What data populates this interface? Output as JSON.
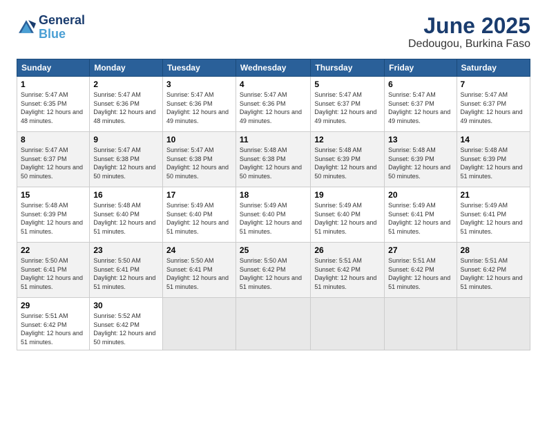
{
  "logo": {
    "line1": "General",
    "line2": "Blue"
  },
  "title": "June 2025",
  "subtitle": "Dedougou, Burkina Faso",
  "headers": [
    "Sunday",
    "Monday",
    "Tuesday",
    "Wednesday",
    "Thursday",
    "Friday",
    "Saturday"
  ],
  "weeks": [
    [
      {
        "day": "1",
        "sunrise": "5:47 AM",
        "sunset": "6:35 PM",
        "daylight": "12 hours and 48 minutes."
      },
      {
        "day": "2",
        "sunrise": "5:47 AM",
        "sunset": "6:36 PM",
        "daylight": "12 hours and 48 minutes."
      },
      {
        "day": "3",
        "sunrise": "5:47 AM",
        "sunset": "6:36 PM",
        "daylight": "12 hours and 49 minutes."
      },
      {
        "day": "4",
        "sunrise": "5:47 AM",
        "sunset": "6:36 PM",
        "daylight": "12 hours and 49 minutes."
      },
      {
        "day": "5",
        "sunrise": "5:47 AM",
        "sunset": "6:37 PM",
        "daylight": "12 hours and 49 minutes."
      },
      {
        "day": "6",
        "sunrise": "5:47 AM",
        "sunset": "6:37 PM",
        "daylight": "12 hours and 49 minutes."
      },
      {
        "day": "7",
        "sunrise": "5:47 AM",
        "sunset": "6:37 PM",
        "daylight": "12 hours and 49 minutes."
      }
    ],
    [
      {
        "day": "8",
        "sunrise": "5:47 AM",
        "sunset": "6:37 PM",
        "daylight": "12 hours and 50 minutes."
      },
      {
        "day": "9",
        "sunrise": "5:47 AM",
        "sunset": "6:38 PM",
        "daylight": "12 hours and 50 minutes."
      },
      {
        "day": "10",
        "sunrise": "5:47 AM",
        "sunset": "6:38 PM",
        "daylight": "12 hours and 50 minutes."
      },
      {
        "day": "11",
        "sunrise": "5:48 AM",
        "sunset": "6:38 PM",
        "daylight": "12 hours and 50 minutes."
      },
      {
        "day": "12",
        "sunrise": "5:48 AM",
        "sunset": "6:39 PM",
        "daylight": "12 hours and 50 minutes."
      },
      {
        "day": "13",
        "sunrise": "5:48 AM",
        "sunset": "6:39 PM",
        "daylight": "12 hours and 50 minutes."
      },
      {
        "day": "14",
        "sunrise": "5:48 AM",
        "sunset": "6:39 PM",
        "daylight": "12 hours and 51 minutes."
      }
    ],
    [
      {
        "day": "15",
        "sunrise": "5:48 AM",
        "sunset": "6:39 PM",
        "daylight": "12 hours and 51 minutes."
      },
      {
        "day": "16",
        "sunrise": "5:48 AM",
        "sunset": "6:40 PM",
        "daylight": "12 hours and 51 minutes."
      },
      {
        "day": "17",
        "sunrise": "5:49 AM",
        "sunset": "6:40 PM",
        "daylight": "12 hours and 51 minutes."
      },
      {
        "day": "18",
        "sunrise": "5:49 AM",
        "sunset": "6:40 PM",
        "daylight": "12 hours and 51 minutes."
      },
      {
        "day": "19",
        "sunrise": "5:49 AM",
        "sunset": "6:40 PM",
        "daylight": "12 hours and 51 minutes."
      },
      {
        "day": "20",
        "sunrise": "5:49 AM",
        "sunset": "6:41 PM",
        "daylight": "12 hours and 51 minutes."
      },
      {
        "day": "21",
        "sunrise": "5:49 AM",
        "sunset": "6:41 PM",
        "daylight": "12 hours and 51 minutes."
      }
    ],
    [
      {
        "day": "22",
        "sunrise": "5:50 AM",
        "sunset": "6:41 PM",
        "daylight": "12 hours and 51 minutes."
      },
      {
        "day": "23",
        "sunrise": "5:50 AM",
        "sunset": "6:41 PM",
        "daylight": "12 hours and 51 minutes."
      },
      {
        "day": "24",
        "sunrise": "5:50 AM",
        "sunset": "6:41 PM",
        "daylight": "12 hours and 51 minutes."
      },
      {
        "day": "25",
        "sunrise": "5:50 AM",
        "sunset": "6:42 PM",
        "daylight": "12 hours and 51 minutes."
      },
      {
        "day": "26",
        "sunrise": "5:51 AM",
        "sunset": "6:42 PM",
        "daylight": "12 hours and 51 minutes."
      },
      {
        "day": "27",
        "sunrise": "5:51 AM",
        "sunset": "6:42 PM",
        "daylight": "12 hours and 51 minutes."
      },
      {
        "day": "28",
        "sunrise": "5:51 AM",
        "sunset": "6:42 PM",
        "daylight": "12 hours and 51 minutes."
      }
    ],
    [
      {
        "day": "29",
        "sunrise": "5:51 AM",
        "sunset": "6:42 PM",
        "daylight": "12 hours and 51 minutes."
      },
      {
        "day": "30",
        "sunrise": "5:52 AM",
        "sunset": "6:42 PM",
        "daylight": "12 hours and 50 minutes."
      },
      null,
      null,
      null,
      null,
      null
    ]
  ]
}
